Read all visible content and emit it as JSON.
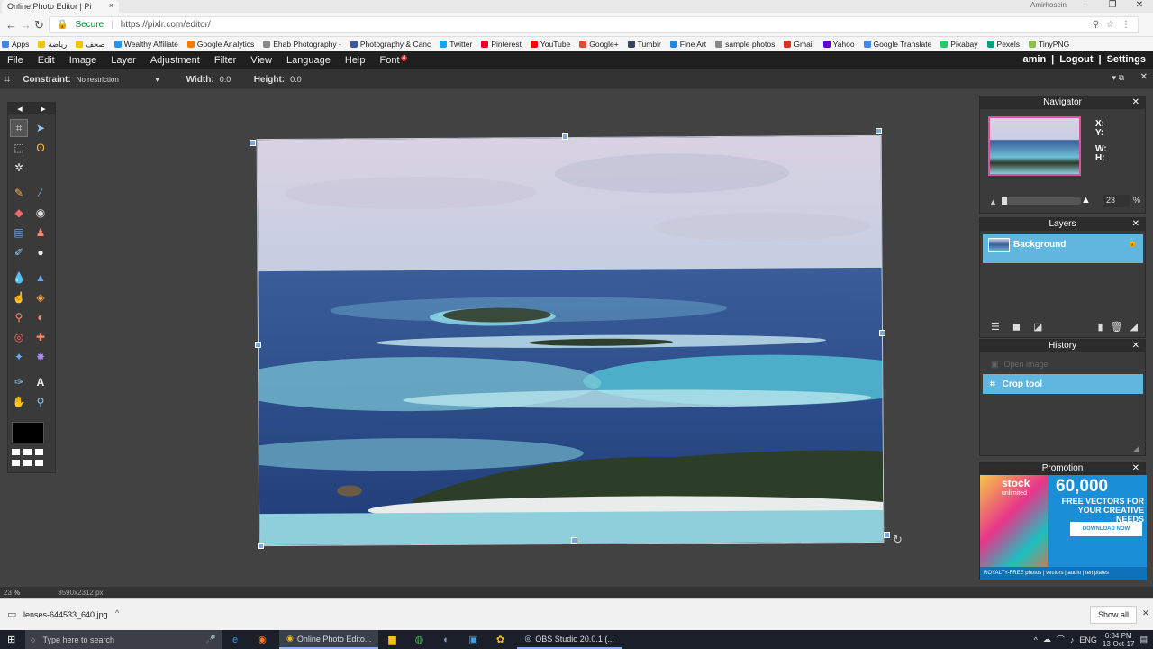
{
  "browser": {
    "tab_title": "Online Photo Editor | Pi",
    "window_user": "Amirhosein",
    "secure_label": "Secure",
    "url": "https://pixlr.com/editor/",
    "bookmarks": [
      {
        "label": "Apps",
        "color": "#4285f4"
      },
      {
        "label": "رياضة",
        "color": "#f4c20d"
      },
      {
        "label": "صحف",
        "color": "#f4c20d"
      },
      {
        "label": "Wealthy Affiliate",
        "color": "#2196f3"
      },
      {
        "label": "Google Analytics",
        "color": "#f57c00"
      },
      {
        "label": "Ehab Photography -",
        "color": "#888888"
      },
      {
        "label": "Photography & Canc",
        "color": "#3b5998"
      },
      {
        "label": "Twitter",
        "color": "#1da1f2"
      },
      {
        "label": "Pinterest",
        "color": "#e60023"
      },
      {
        "label": "YouTube",
        "color": "#ff0000"
      },
      {
        "label": "Google+",
        "color": "#dd4b39"
      },
      {
        "label": "Tumblr",
        "color": "#35465c"
      },
      {
        "label": "Fine Art",
        "color": "#1e88e5"
      },
      {
        "label": "sample photos",
        "color": "#888888"
      },
      {
        "label": "Gmail",
        "color": "#d93025"
      },
      {
        "label": "Yahoo",
        "color": "#6001d2"
      },
      {
        "label": "Google Translate",
        "color": "#4285f4"
      },
      {
        "label": "Pixabay",
        "color": "#2ec66d"
      },
      {
        "label": "Pexels",
        "color": "#05a081"
      },
      {
        "label": "TinyPNG",
        "color": "#8bc34a"
      }
    ]
  },
  "menu": {
    "items": [
      "File",
      "Edit",
      "Image",
      "Layer",
      "Adjustment",
      "Filter",
      "View",
      "Language",
      "Help"
    ],
    "font_label": "Font",
    "font_badge": "4",
    "user": "amin",
    "logout": "Logout",
    "settings": "Settings"
  },
  "options": {
    "constraint_label": "Constraint:",
    "constraint_value": "No restriction",
    "width_label": "Width:",
    "width_value": "0.0",
    "height_label": "Height:",
    "height_value": "0.0"
  },
  "navigator": {
    "title": "Navigator",
    "x_label": "X:",
    "y_label": "Y:",
    "w_label": "W:",
    "h_label": "H:",
    "zoom_value": "23",
    "zoom_unit": "%"
  },
  "layers": {
    "title": "Layers",
    "items": [
      {
        "label": "Background"
      }
    ]
  },
  "history": {
    "title": "History",
    "items": [
      "Open image",
      "Crop tool"
    ]
  },
  "promotion": {
    "title": "Promotion",
    "brand": "stock",
    "brand_sub": "unlimited",
    "headline_number": "60,000",
    "headline_line1": "FREE VECTORS FOR",
    "headline_line2": "YOUR CREATIVE NEEDS",
    "cta": "DOWNLOAD NOW",
    "footer": "ROYALTY-FREE  photos | vectors | audio | templates"
  },
  "status": {
    "zoom": "23",
    "zoom_unit": "%",
    "dimensions": "3590x2312 px"
  },
  "download": {
    "filename": "lenses-644533_640.jpg",
    "show_all": "Show all"
  },
  "taskbar": {
    "search_placeholder": "Type here to search",
    "app1": "Online Photo Edito...",
    "app2": "OBS Studio 20.0.1 (...",
    "lang": "ENG",
    "time": "6:34 PM",
    "date": "13-Oct-17"
  }
}
